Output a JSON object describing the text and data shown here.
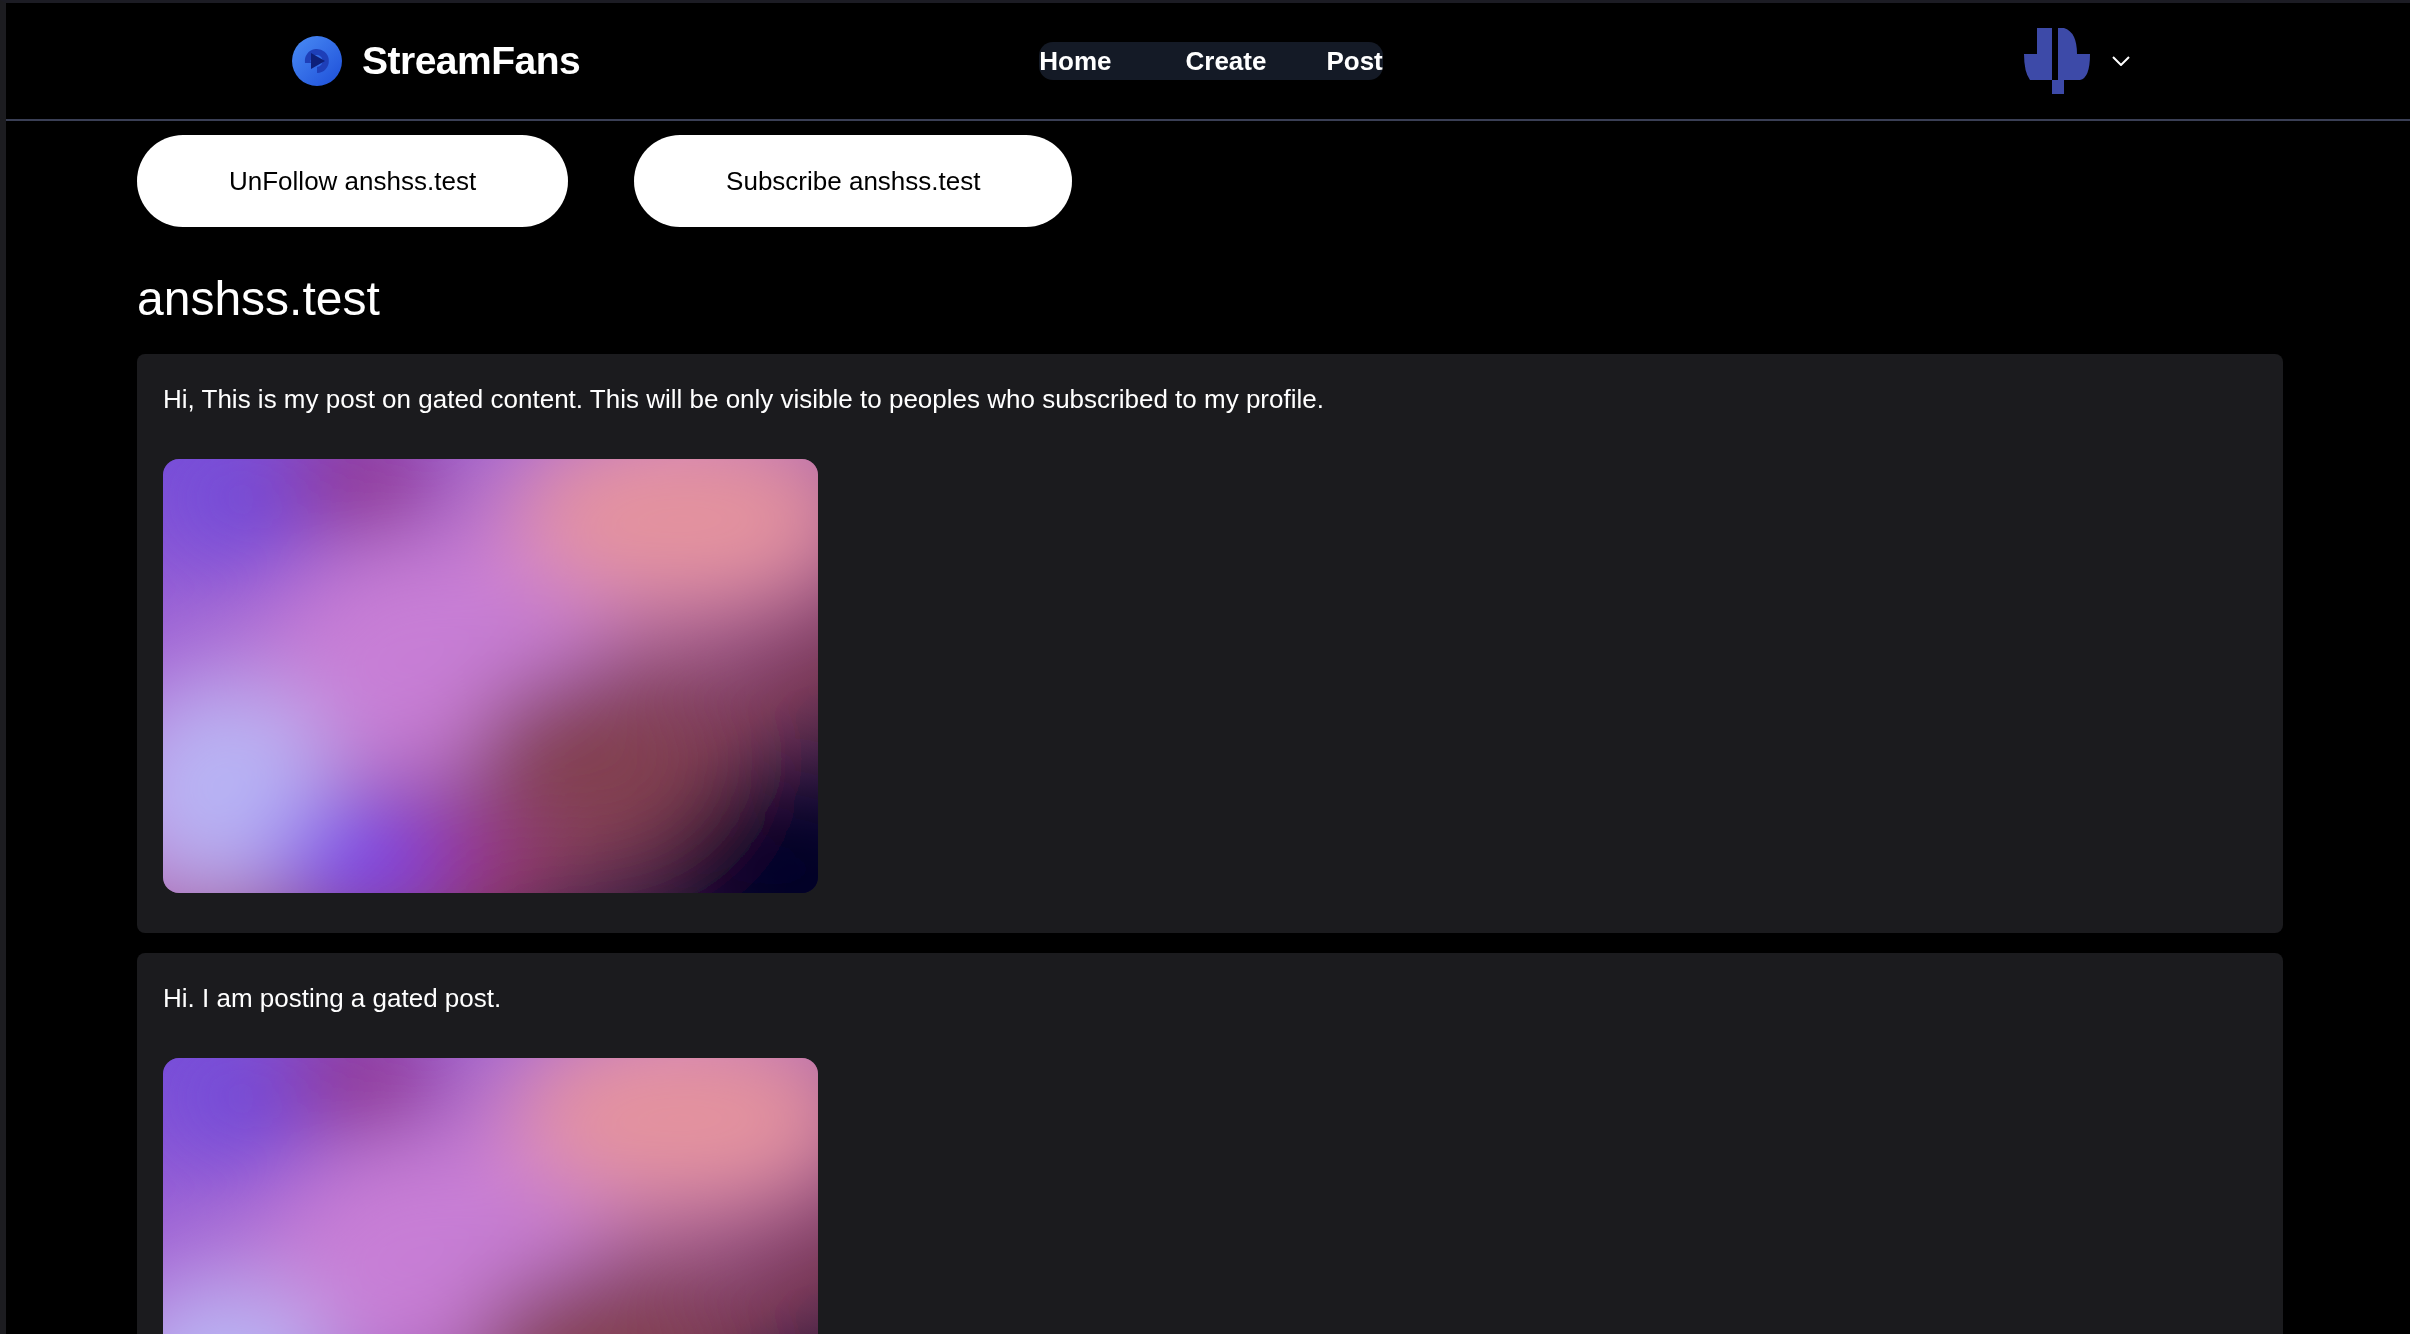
{
  "header": {
    "brand": "StreamFans",
    "nav": [
      {
        "label": "Home"
      },
      {
        "label": "Create"
      },
      {
        "label": "Post"
      }
    ]
  },
  "actions": [
    {
      "label": "UnFollow anshss.test"
    },
    {
      "label": "Subscribe anshss.test"
    }
  ],
  "profile": {
    "name": "anshss.test"
  },
  "posts": [
    {
      "text": "Hi, This is my post on gated content. This will be only visible to peoples who subscribed to my profile."
    },
    {
      "text": "Hi. I am posting a gated post."
    }
  ]
}
